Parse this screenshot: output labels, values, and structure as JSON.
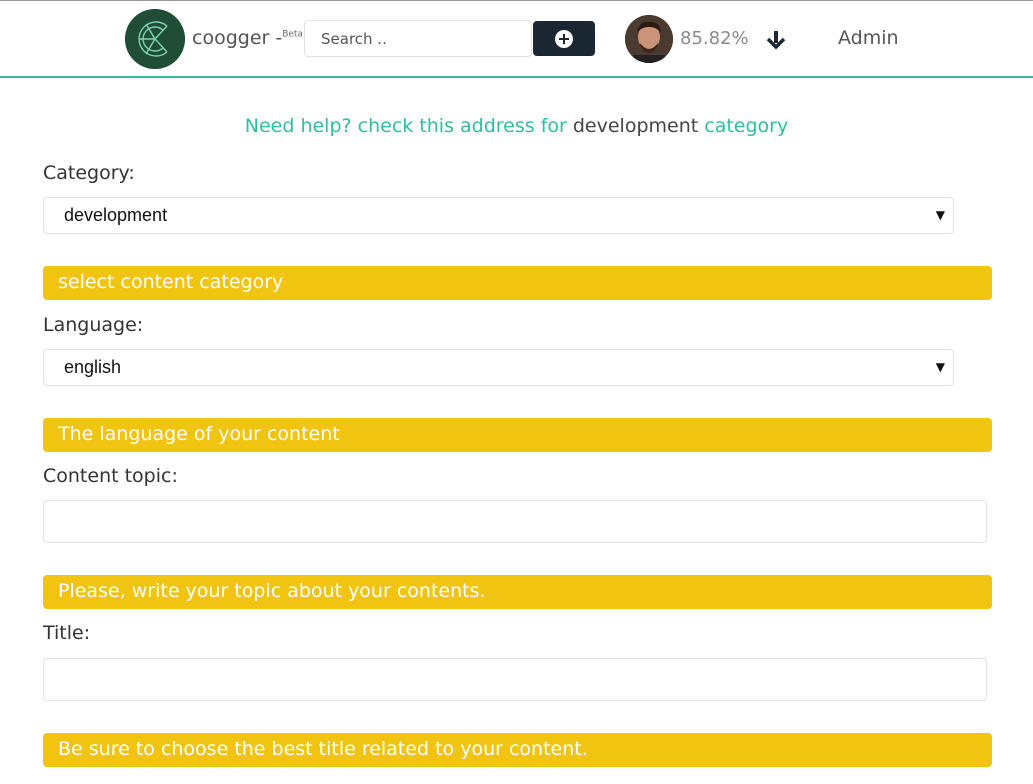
{
  "header": {
    "brand": "coogger",
    "brand_dash": "-",
    "brand_beta": "Beta",
    "search_placeholder": "Search ..",
    "voting_power": "85.82%",
    "admin_label": "Admin",
    "accent_color": "#2fbf9f"
  },
  "help": {
    "prefix": "Need help? check this address for",
    "category_name": "development",
    "suffix": "category"
  },
  "form": {
    "category": {
      "label": "Category:",
      "selected": "development",
      "hint": "select content category"
    },
    "language": {
      "label": "Language:",
      "selected": "english",
      "hint": "The language of your content"
    },
    "topic": {
      "label": "Content topic:",
      "value": "",
      "hint": "Please, write your topic about your contents."
    },
    "title": {
      "label": "Title:",
      "value": "",
      "hint": "Be sure to choose the best title related to your content."
    }
  },
  "icons": {
    "add": "plus-circle-icon",
    "down": "arrow-down-icon",
    "caret": "caret-down-icon"
  },
  "colors": {
    "hint_bg": "#f0c410",
    "button_bg": "#1b2733"
  }
}
